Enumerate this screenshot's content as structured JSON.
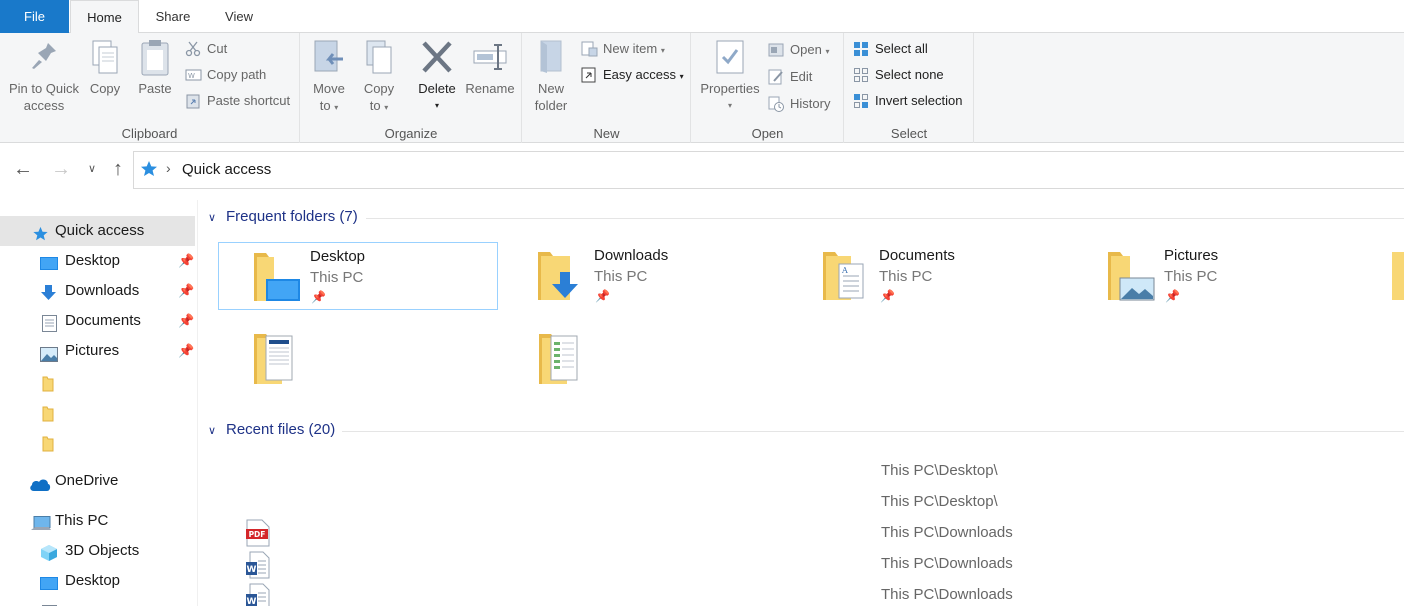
{
  "tabs": {
    "file": "File",
    "home": "Home",
    "share": "Share",
    "view": "View"
  },
  "ribbon": {
    "clipboard": {
      "label": "Clipboard",
      "pin_line1": "Pin to Quick",
      "pin_line2": "access",
      "copy": "Copy",
      "paste": "Paste",
      "cut": "Cut",
      "copy_path": "Copy path",
      "paste_shortcut": "Paste shortcut"
    },
    "organize": {
      "label": "Organize",
      "move_line1": "Move",
      "move_line2": "to",
      "copy_line1": "Copy",
      "copy_line2": "to",
      "delete": "Delete",
      "rename": "Rename"
    },
    "new": {
      "label": "New",
      "folder_line1": "New",
      "folder_line2": "folder",
      "new_item": "New item",
      "easy_access": "Easy access"
    },
    "open": {
      "label": "Open",
      "properties": "Properties",
      "open": "Open",
      "edit": "Edit",
      "history": "History"
    },
    "select": {
      "label": "Select",
      "select_all": "Select all",
      "select_none": "Select none",
      "invert": "Invert selection"
    }
  },
  "address": {
    "crumb": "Quick access"
  },
  "sidebar": {
    "quick_access": "Quick access",
    "items": [
      {
        "label": "Desktop"
      },
      {
        "label": "Downloads"
      },
      {
        "label": "Documents"
      },
      {
        "label": "Pictures"
      }
    ],
    "onedrive": "OneDrive",
    "this_pc": "This PC",
    "three_d": "3D Objects",
    "desktop2": "Desktop"
  },
  "frequent": {
    "header": "Frequent folders (7)",
    "tiles": [
      {
        "name": "Desktop",
        "location": "This PC"
      },
      {
        "name": "Downloads",
        "location": "This PC"
      },
      {
        "name": "Documents",
        "location": "This PC"
      },
      {
        "name": "Pictures",
        "location": "This PC"
      }
    ]
  },
  "recent": {
    "header": "Recent files (20)",
    "paths": [
      "This PC\\Desktop\\",
      "This PC\\Desktop\\",
      "This PC\\Downloads",
      "This PC\\Downloads",
      "This PC\\Downloads"
    ],
    "pdf_badge": "PDF",
    "word_badge": "W"
  },
  "colors": {
    "accent": "#1979ca",
    "folder": "#f8d775",
    "folder_dark": "#e8b94a",
    "header_blue": "#1e3287",
    "selection": "#99d1ff"
  }
}
